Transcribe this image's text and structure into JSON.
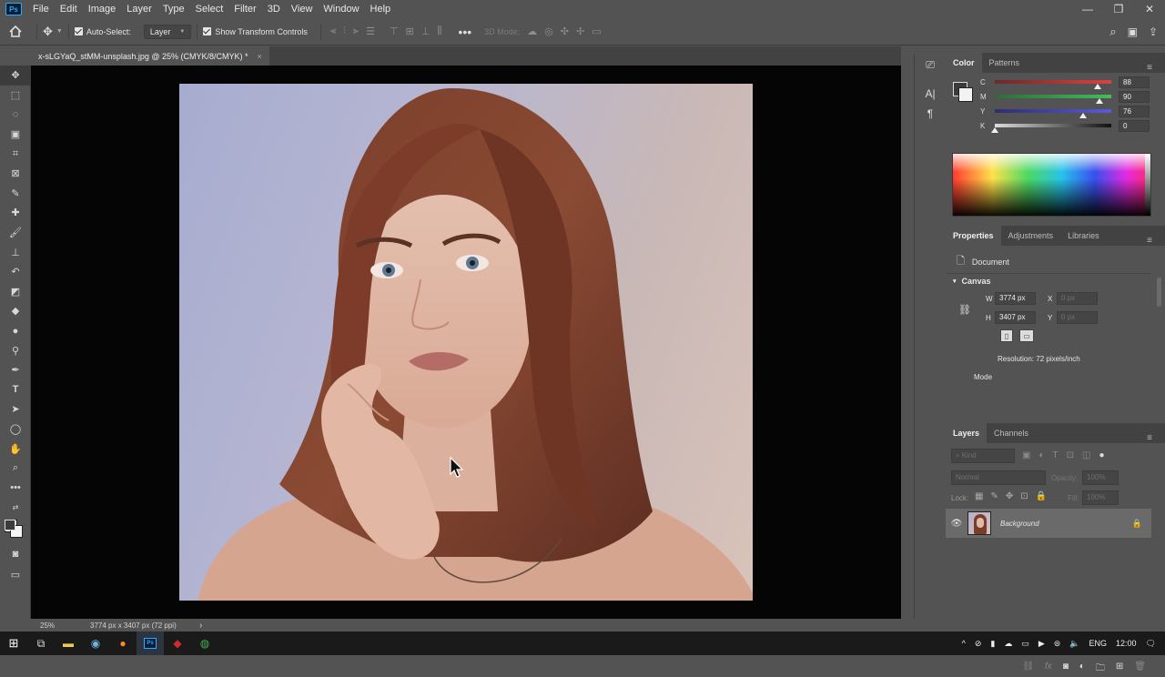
{
  "menubar": {
    "app_logo": "Ps",
    "items": [
      "File",
      "Edit",
      "Image",
      "Layer",
      "Type",
      "Select",
      "Filter",
      "3D",
      "View",
      "Window",
      "Help"
    ]
  },
  "options": {
    "auto_select_label": "Auto-Select:",
    "auto_select_target": "Layer",
    "show_transform_label": "Show Transform Controls",
    "mode_3d_label": "3D Mode:"
  },
  "document": {
    "tab_title": "x-sLGYaQ_stMM-unsplash.jpg @ 25% (CMYK/8/CMYK) *",
    "close": "×"
  },
  "status": {
    "zoom": "25%",
    "doc_info": "3774 px x 3407 px (72 ppi)",
    "arrow": "›"
  },
  "color_panel": {
    "tabs": [
      "Color",
      "Patterns"
    ],
    "channels": [
      {
        "name": "C",
        "value": "88",
        "fraction": 0.88,
        "color_a": "#6b2a2a",
        "color_b": "#e04040"
      },
      {
        "name": "M",
        "value": "90",
        "fraction": 0.9,
        "color_a": "#2f6b3a",
        "color_b": "#3fbf5a"
      },
      {
        "name": "Y",
        "value": "76",
        "fraction": 0.76,
        "color_a": "#2f2f6b",
        "color_b": "#5a5ad8"
      },
      {
        "name": "K",
        "value": "0",
        "fraction": 0.0,
        "color_a": "#dcdcdc",
        "color_b": "#111111"
      }
    ]
  },
  "properties_panel": {
    "tabs": [
      "Properties",
      "Adjustments",
      "Libraries"
    ],
    "doc_label": "Document",
    "section": "Canvas",
    "w_label": "W",
    "w_value": "3774 px",
    "h_label": "H",
    "h_value": "3407 px",
    "x_label": "X",
    "x_value": "0 px",
    "y_label": "Y",
    "y_value": "0 px",
    "resolution": "Resolution: 72 pixels/inch",
    "mode_label": "Mode"
  },
  "layers_panel": {
    "tabs": [
      "Layers",
      "Channels"
    ],
    "kind_placeholder": "Kind",
    "blend_mode": "Normal",
    "opacity_label": "Opacity:",
    "opacity_value": "100%",
    "lock_label": "Lock:",
    "fill_label": "Fill:",
    "fill_value": "100%",
    "layers": [
      {
        "name": "Background",
        "visible": true,
        "locked": true
      }
    ]
  },
  "taskbar": {
    "lang": "ENG",
    "time": "12:00"
  }
}
